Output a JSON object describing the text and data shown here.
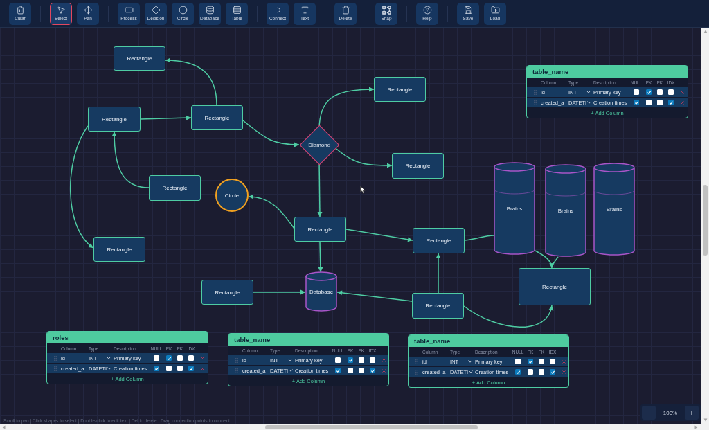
{
  "toolbar": {
    "groups": [
      {
        "tools": [
          {
            "kind": "clear",
            "label": "Clear",
            "selected": false
          }
        ]
      },
      {
        "tools": [
          {
            "kind": "select",
            "label": "Select",
            "selected": true
          },
          {
            "kind": "pan",
            "label": "Pan",
            "selected": false
          }
        ]
      },
      {
        "tools": [
          {
            "kind": "process",
            "label": "Process",
            "selected": false
          },
          {
            "kind": "decision",
            "label": "Decision",
            "selected": false
          },
          {
            "kind": "circle",
            "label": "Circle",
            "selected": false
          },
          {
            "kind": "database",
            "label": "Database",
            "selected": false
          },
          {
            "kind": "table",
            "label": "Table",
            "selected": false
          }
        ]
      },
      {
        "tools": [
          {
            "kind": "connect",
            "label": "Connect",
            "selected": false
          },
          {
            "kind": "text",
            "label": "Text",
            "selected": false
          }
        ]
      },
      {
        "tools": [
          {
            "kind": "delete",
            "label": "Delete",
            "selected": false
          }
        ]
      },
      {
        "tools": [
          {
            "kind": "snap",
            "label": "Snap",
            "selected": false
          }
        ]
      },
      {
        "tools": [
          {
            "kind": "help",
            "label": "Help",
            "selected": false
          }
        ]
      },
      {
        "tools": [
          {
            "kind": "save",
            "label": "Save",
            "selected": false
          },
          {
            "kind": "load",
            "label": "Load",
            "selected": false
          }
        ]
      }
    ]
  },
  "canvas": {
    "shapes": [
      {
        "kind": "rectangle",
        "label": "Rectangle"
      },
      {
        "kind": "rectangle",
        "label": "Rectangle"
      },
      {
        "kind": "rectangle",
        "label": "Rectangle"
      },
      {
        "kind": "rectangle",
        "label": "Rectangle"
      },
      {
        "kind": "diamond",
        "label": "Diamond"
      },
      {
        "kind": "rectangle",
        "label": "Rectangle"
      },
      {
        "kind": "rectangle",
        "label": "Rectangle"
      },
      {
        "kind": "circle",
        "label": "Circle"
      },
      {
        "kind": "database",
        "label": "Brains"
      },
      {
        "kind": "database",
        "label": "Brains"
      },
      {
        "kind": "database",
        "label": "Brains"
      },
      {
        "kind": "rectangle",
        "label": "Rectangle"
      },
      {
        "kind": "rectangle",
        "label": "Rectangle"
      },
      {
        "kind": "rectangle",
        "label": "Rectangle"
      },
      {
        "kind": "rectangle",
        "label": "Rectangle"
      },
      {
        "kind": "rectangle",
        "label": "Rectangle"
      },
      {
        "kind": "database",
        "label": "Database"
      },
      {
        "kind": "rectangle",
        "label": "Rectangle"
      }
    ],
    "tables": [
      {
        "name": "table_name",
        "columns": [
          "Column",
          "Type",
          "Description",
          "NULL",
          "PK",
          "FK",
          "IDX"
        ],
        "rows": [
          {
            "column": "id",
            "type": "INT",
            "description": "Primary key",
            "null": false,
            "pk": true,
            "fk": false,
            "idx": false
          },
          {
            "column": "created_a",
            "type": "DATETI",
            "description": "Creation times",
            "null": true,
            "pk": false,
            "fk": false,
            "idx": true
          }
        ],
        "add_button": "+ Add Column"
      },
      {
        "name": "roles",
        "columns": [
          "Column",
          "Type",
          "Description",
          "NULL",
          "PK",
          "FK",
          "IDX"
        ],
        "rows": [
          {
            "column": "id",
            "type": "INT",
            "description": "Primary key",
            "null": false,
            "pk": true,
            "fk": false,
            "idx": false
          },
          {
            "column": "created_a",
            "type": "DATETI",
            "description": "Creation times",
            "null": true,
            "pk": false,
            "fk": false,
            "idx": true
          }
        ],
        "add_button": "+ Add Column"
      },
      {
        "name": "table_name",
        "columns": [
          "Column",
          "Type",
          "Description",
          "NULL",
          "PK",
          "FK",
          "IDX"
        ],
        "rows": [
          {
            "column": "id",
            "type": "INT",
            "description": "Primary key",
            "null": false,
            "pk": true,
            "fk": false,
            "idx": false
          },
          {
            "column": "created_a",
            "type": "DATETI",
            "description": "Creation times",
            "null": true,
            "pk": false,
            "fk": false,
            "idx": true
          }
        ],
        "add_button": "+ Add Column"
      },
      {
        "name": "table_name",
        "columns": [
          "Column",
          "Type",
          "Description",
          "NULL",
          "PK",
          "FK",
          "IDX"
        ],
        "rows": [
          {
            "column": "id",
            "type": "INT",
            "description": "Primary key",
            "null": false,
            "pk": true,
            "fk": false,
            "idx": false
          },
          {
            "column": "created_a",
            "type": "DATETI",
            "description": "Creation times",
            "null": true,
            "pk": false,
            "fk": false,
            "idx": true
          }
        ],
        "add_button": "+ Add Column"
      }
    ]
  },
  "zoom": {
    "out_button": "−",
    "percent": "100%",
    "in_button": "+"
  },
  "status_bar": {
    "hint": "Scroll to pan | Click shapes to select | Double-click to edit text | Del to delete | Drag connection points to connect"
  }
}
